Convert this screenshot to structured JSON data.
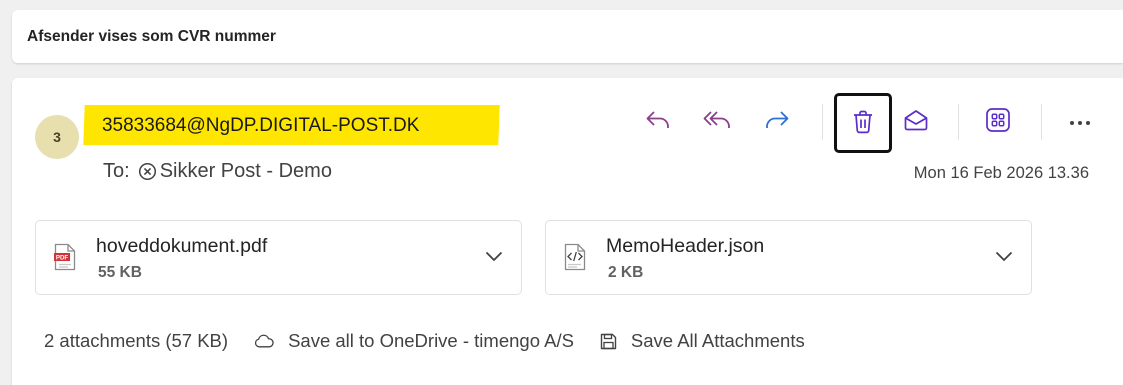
{
  "subject": "Afsender vises som CVR nummer",
  "message": {
    "avatar_initial": "3",
    "sender": "35833684@NgDP.DIGITAL-POST.DK",
    "to_label": "To:",
    "recipient": "Sikker Post - Demo",
    "date": "Mon 16 Feb 2026 13.36"
  },
  "toolbar": {
    "accent_color": "#8a3e8c",
    "forward_color": "#2f6fd6",
    "delete_color": "#5b2dc9"
  },
  "attachments": [
    {
      "name": "hoveddokument.pdf",
      "size": "55 KB",
      "icon": "pdf-icon"
    },
    {
      "name": "MemoHeader.json",
      "size": "2 KB",
      "icon": "code-file-icon"
    }
  ],
  "footer": {
    "summary": "2 attachments (57 KB)",
    "save_onedrive": "Save all to OneDrive - timengo A/S",
    "save_all": "Save All Attachments"
  }
}
